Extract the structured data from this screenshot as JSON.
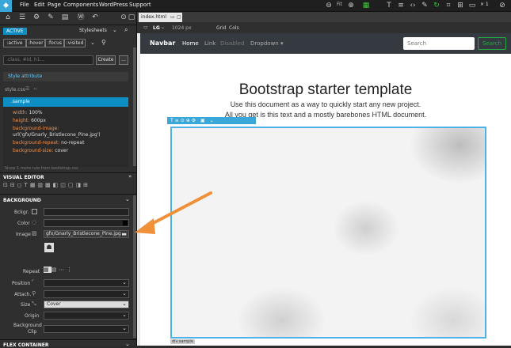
{
  "menubar": {
    "items": [
      "File",
      "Edit",
      "Page",
      "Components",
      "WordPress",
      "Support"
    ],
    "zoom_label": "Fit",
    "count_label": "× 1"
  },
  "left": {
    "tabs": {
      "active": "ACTIVE",
      "stylesheets": "Stylesheets"
    },
    "pseudo": [
      ":active",
      ":hover",
      ":focus",
      ":visited"
    ],
    "selector_placeholder": ".class, #id, h1...",
    "create_label": "Create",
    "more_label": "...",
    "style_attribute": "Style attribute",
    "stylesheet_file": "style.css",
    "rule_selector": ".sample",
    "properties": [
      {
        "k": "width:",
        "v": "100%"
      },
      {
        "k": "height:",
        "v": "600px"
      },
      {
        "k": "background-image:",
        "v": ""
      },
      {
        "k": "",
        "v": "url('gfx/Gnarly_Bristlecone_Pine.jpg')"
      },
      {
        "k": "background-repeat:",
        "v": "no-repeat"
      },
      {
        "k": "background-size:",
        "v": "cover"
      }
    ],
    "more_rules": "Show 1 more rule from bootstrap.css",
    "visual_editor": "VISUAL EDITOR",
    "background_section": "BACKGROUND",
    "fields": {
      "bckgr": "Bckgr.",
      "color": "Color",
      "image": "Image",
      "image_value": "gfx/Gnarly_Bristlecone_Pine.jpg",
      "repeat": "Repeat",
      "position": "Position",
      "attach": "Attach.",
      "size": "Size",
      "size_value": "Cover",
      "origin": "Origin",
      "bgclip": "Background",
      "bgclip2": "Clip"
    },
    "flex_section": "FLEX CONTAINER"
  },
  "right": {
    "tab": "index.html",
    "device": "LG",
    "width": "1024 px",
    "grid": "Grid",
    "cols": "Cols",
    "navbar": {
      "brand": "Navbar",
      "links": [
        "Home",
        "Link",
        "Disabled",
        "Dropdown ▾"
      ],
      "search_placeholder": "Search",
      "search_button": "Search"
    },
    "page": {
      "title": "Bootstrap starter template",
      "lead1": "Use this document as a way to quickly start any new project.",
      "lead2": "All you get is this text and a mostly barebones HTML document.",
      "selected_tag": "div.sample"
    }
  },
  "colors": {
    "accent": "#3aa7d9",
    "arrow": "#f0913a",
    "success": "#28a745"
  }
}
